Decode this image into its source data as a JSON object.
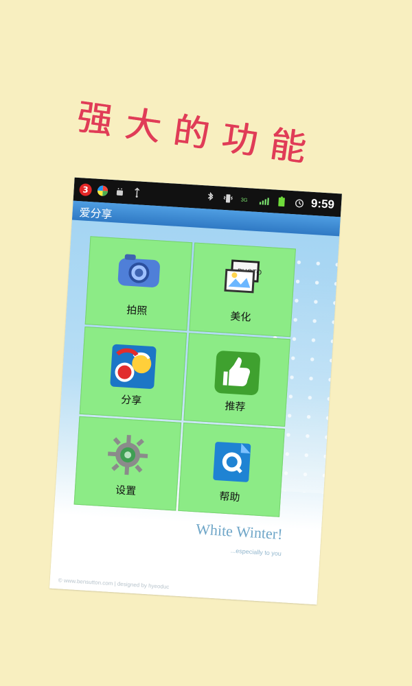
{
  "background": {
    "color": "#f8efc0"
  },
  "headline": {
    "text": "强大的功能",
    "color": "#e03c57"
  },
  "phone": {
    "status": {
      "notification_count": "3",
      "time": "9:59"
    },
    "app_title": "爱分享",
    "tiles": [
      {
        "label": "拍照",
        "icon": "camera-icon"
      },
      {
        "label": "美化",
        "icon": "photo-edit-icon"
      },
      {
        "label": "分享",
        "icon": "share-icon"
      },
      {
        "label": "推荐",
        "icon": "thumbs-up-icon"
      },
      {
        "label": "设置",
        "icon": "gear-icon"
      },
      {
        "label": "帮助",
        "icon": "help-icon"
      }
    ],
    "watermark": {
      "title": "White Winter!",
      "subtitle": "...especially to you"
    },
    "credit": "© www.bensutton.com | designed by hyeoduc"
  }
}
